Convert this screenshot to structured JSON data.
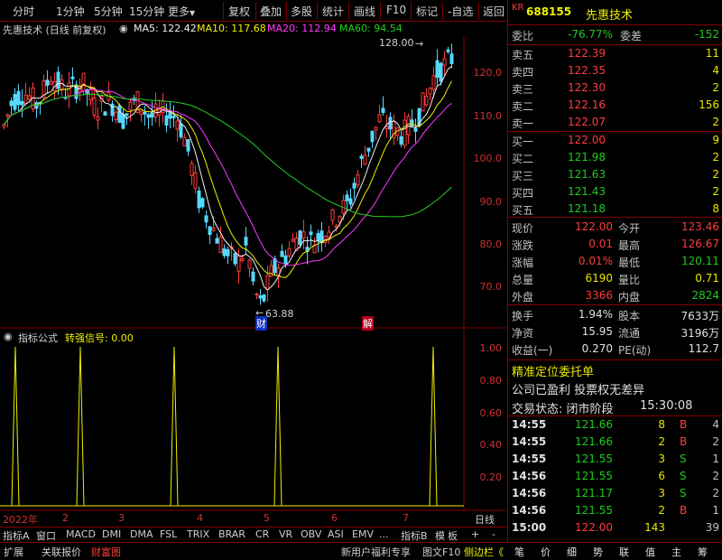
{
  "toolbar": {
    "items": [
      "分时",
      "1分钟",
      "5分钟",
      "15分钟",
      "更多",
      "复权",
      "叠加",
      "多股",
      "统计",
      "画线",
      "F10",
      "标记",
      "-自选",
      "返回"
    ]
  },
  "stock": {
    "market_tag": "KR",
    "code": "688155",
    "name": "先惠技术"
  },
  "chart": {
    "title": "先惠技术 (日线 前复权)",
    "ma5_label": "MA5: 122.42",
    "ma10_label": "MA10: 117.68",
    "ma20_label": "MA20: 112.94",
    "ma60_label": "MA60: 94.54",
    "high_marker": "128.00",
    "low_marker": "63.88",
    "y_ticks": [
      "120.0",
      "110.0",
      "100.0",
      "90.0",
      "80.0",
      "70.0"
    ],
    "event_tags": [
      "财",
      "解"
    ],
    "colors": {
      "up": "#ff3c3c",
      "down": "#54d8ff",
      "ma5": "#f0f0f0",
      "ma10": "#f0f000",
      "ma20": "#ff3cff",
      "ma60": "#20d020"
    }
  },
  "indicator": {
    "title": "指标公式",
    "signal_label": "转强信号: 0.00",
    "y_ticks": [
      "1.00",
      "0.80",
      "0.60",
      "0.40",
      "0.20"
    ]
  },
  "x_axis": {
    "labels": [
      "2022年",
      "2",
      "3",
      "4",
      "5",
      "6",
      "7"
    ],
    "period": "日线"
  },
  "indicator_tabs": [
    "指标A",
    "窗口",
    "MACD",
    "DMI",
    "DMA",
    "FSL",
    "TRIX",
    "BRAR",
    "CR",
    "VR",
    "OBV",
    "ASI",
    "EMV",
    "...",
    "指标B",
    "模",
    "板",
    "+",
    "-"
  ],
  "bottom_bar": {
    "left": [
      "扩展",
      "关联报价",
      "财富图"
    ],
    "right": [
      "新用户福利专享",
      "图文F10",
      "侧边栏《"
    ],
    "icons": [
      "笔",
      "价",
      "细",
      "势",
      "联",
      "值",
      "主",
      "筹"
    ]
  },
  "order_book": {
    "weibi_label": "委比",
    "weibi": "-76.77%",
    "weicha_label": "委差",
    "weicha": "-152",
    "asks": [
      {
        "label": "卖五",
        "price": "122.39",
        "vol": "11"
      },
      {
        "label": "卖四",
        "price": "122.35",
        "vol": "4"
      },
      {
        "label": "卖三",
        "price": "122.30",
        "vol": "2"
      },
      {
        "label": "卖二",
        "price": "122.16",
        "vol": "156"
      },
      {
        "label": "卖一",
        "price": "122.07",
        "vol": "2"
      }
    ],
    "bids": [
      {
        "label": "买一",
        "price": "122.00",
        "vol": "9"
      },
      {
        "label": "买二",
        "price": "121.98",
        "vol": "2"
      },
      {
        "label": "买三",
        "price": "121.63",
        "vol": "2"
      },
      {
        "label": "买四",
        "price": "121.43",
        "vol": "2"
      },
      {
        "label": "买五",
        "price": "121.18",
        "vol": "8"
      }
    ]
  },
  "quote": [
    {
      "l1": "现价",
      "v1": "122.00",
      "c1": "red",
      "l2": "今开",
      "v2": "123.46",
      "c2": "red"
    },
    {
      "l1": "涨跌",
      "v1": "0.01",
      "c1": "red",
      "l2": "最高",
      "v2": "126.67",
      "c2": "red"
    },
    {
      "l1": "涨幅",
      "v1": "0.01%",
      "c1": "red",
      "l2": "最低",
      "v2": "120.11",
      "c2": "green"
    },
    {
      "l1": "总量",
      "v1": "6190",
      "c1": "yellow",
      "l2": "量比",
      "v2": "0.71",
      "c2": "yellow"
    },
    {
      "l1": "外盘",
      "v1": "3366",
      "c1": "red",
      "l2": "内盘",
      "v2": "2824",
      "c2": "green"
    }
  ],
  "stats": [
    {
      "l1": "换手",
      "v1": "1.94%",
      "l2": "股本",
      "v2": "7633万"
    },
    {
      "l1": "净资",
      "v1": "15.95",
      "l2": "流通",
      "v2": "3196万"
    },
    {
      "l1": "收益(一)",
      "v1": "0.270",
      "l2": "PE(动)",
      "v2": "112.7"
    }
  ],
  "promo": {
    "line1": "精准定位委托单",
    "line2": "公司已盈利 投票权无差异",
    "status_label": "交易状态: 闭市阶段",
    "status_time": "15:30:08"
  },
  "trades": [
    {
      "time": "14:55",
      "price": "121.66",
      "vol": "8",
      "side": "B",
      "n": "4"
    },
    {
      "time": "14:55",
      "price": "121.66",
      "vol": "2",
      "side": "B",
      "n": "2"
    },
    {
      "time": "14:55",
      "price": "121.55",
      "vol": "3",
      "side": "S",
      "n": "1"
    },
    {
      "time": "14:56",
      "price": "121.55",
      "vol": "6",
      "side": "S",
      "n": "2"
    },
    {
      "time": "14:56",
      "price": "121.17",
      "vol": "3",
      "side": "S",
      "n": "2"
    },
    {
      "time": "14:56",
      "price": "121.55",
      "vol": "2",
      "side": "B",
      "n": "1"
    },
    {
      "time": "15:00",
      "price": "122.00",
      "vol": "143",
      "side": "",
      "n": "39"
    }
  ]
}
